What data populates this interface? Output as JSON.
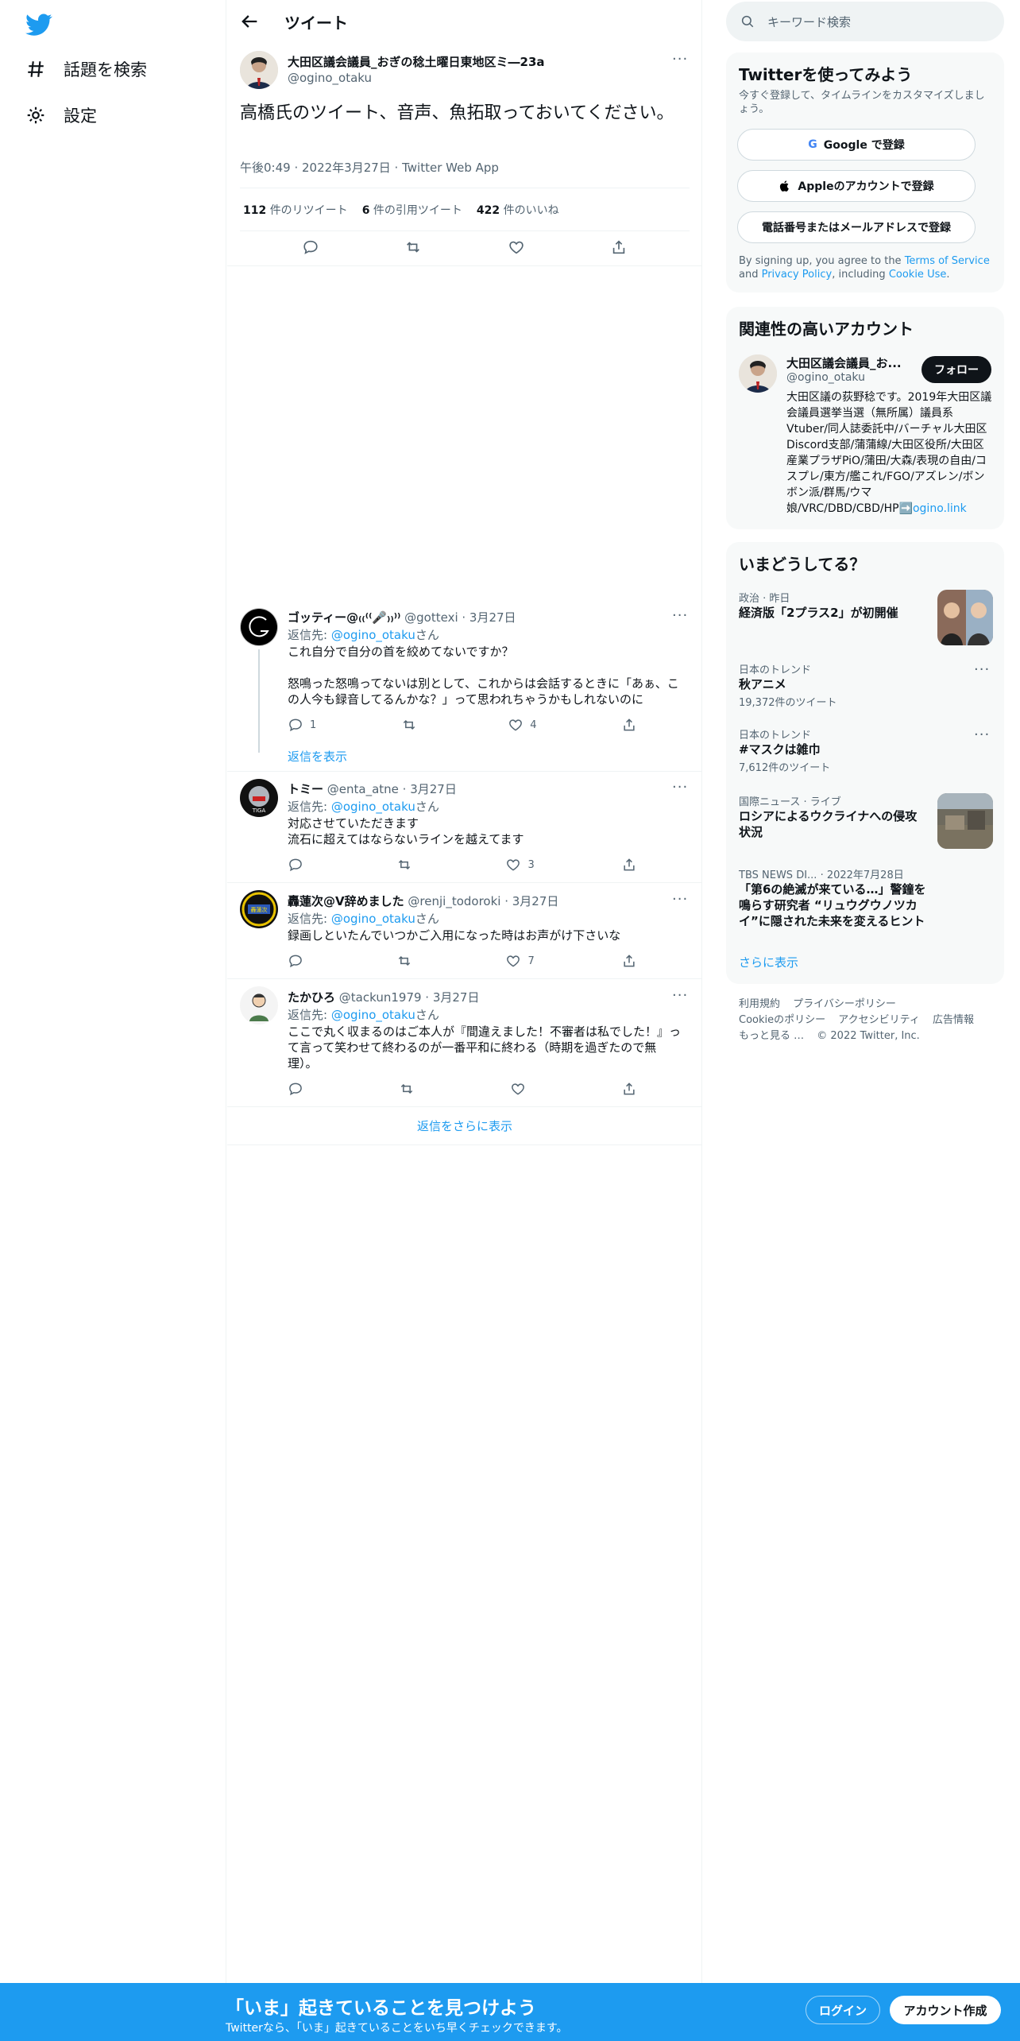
{
  "nav": {
    "logo_icon": "twitter-bird-icon",
    "explore_label": "話題を検索",
    "settings_label": "設定"
  },
  "header": {
    "title": "ツイート"
  },
  "main_tweet": {
    "author_name": "大田区議会議員_おぎの稔土曜日東地区ミ―23a",
    "handle": "@ogino_otaku",
    "text": "高橋氏のツイート、音声、魚拓取っておいてください。",
    "meta": "午後0:49 · 2022年3月27日 · Twitter Web App",
    "retweets_count": "112",
    "retweets_label": "件のリツイート",
    "quotes_count": "6",
    "quotes_label": "件の引用ツイート",
    "likes_count": "422",
    "likes_label": "件のいいね"
  },
  "replies": [
    {
      "name": "ゴッティー@₍₍⁽⁽🎤₎₎⁾⁾",
      "handle": "@gottexi · 3月27日",
      "reply_prefix": "返信先: ",
      "reply_to": "@ogino_otaku",
      "reply_suffix": "さん",
      "text_line1": "これ自分で自分の首を絞めてないですか？",
      "text_line2": "怒鳴った怒鳴ってないは別として、これからは会話するときに「あぁ、この人今も録音してるんかな？」って思われちゃうかもしれないのに",
      "reply_count": "1",
      "retweet_count": "",
      "like_count": "4",
      "show_replies": "返信を表示"
    },
    {
      "name": "トミー",
      "handle": "@enta_atne · 3月27日",
      "reply_prefix": "返信先: ",
      "reply_to": "@ogino_otaku",
      "reply_suffix": "さん",
      "text_line1": "対応させていただきます",
      "text_line2": "流石に超えてはならないラインを越えてます",
      "reply_count": "",
      "retweet_count": "",
      "like_count": "3"
    },
    {
      "name": "轟蓮次@V辞めました",
      "handle": "@renji_todoroki · 3月27日",
      "reply_prefix": "返信先: ",
      "reply_to": "@ogino_otaku",
      "reply_suffix": "さん",
      "text_line1": "録画しといたんでいつかご入用になった時はお声がけ下さいな",
      "reply_count": "",
      "retweet_count": "",
      "like_count": "7"
    },
    {
      "name": "たかひろ",
      "handle": "@tackun1979 · 3月27日",
      "reply_prefix": "返信先: ",
      "reply_to": "@ogino_otaku",
      "reply_suffix": "さん",
      "text_line1": "ここで丸く収まるのはご本人が『間違えました！不審者は私でした！』って言って笑わせて終わるのが一番平和に終わる（時期を過ぎたので無理）。",
      "reply_count": "",
      "retweet_count": "",
      "like_count": ""
    }
  ],
  "show_more_replies": "返信をさらに表示",
  "search": {
    "placeholder": "キーワード検索"
  },
  "signup_panel": {
    "title": "Twitterを使ってみよう",
    "subtitle": "今すぐ登録して、タイムラインをカスタマイズしましょう。",
    "google_btn": "Google で登録",
    "apple_btn": "Appleのアカウントで登録",
    "email_btn": "電話番号またはメールアドレスで登録",
    "tos_prefix": "By signing up, you agree to the ",
    "tos_link": "Terms of Service",
    "tos_and": " and ",
    "privacy_link": "Privacy Policy",
    "tos_incl": ", including ",
    "cookie_link": "Cookie Use",
    "tos_end": "."
  },
  "related_panel": {
    "title": "関連性の高いアカウント",
    "name": "大田区議会議員_お...",
    "handle": "@ogino_otaku",
    "follow_btn": "フォロー",
    "bio": "大田区議の荻野稔です。2019年大田区議会議員選挙当選（無所属）議員系Vtuber/同人誌委託中/バーチャル大田区Discord支部/蒲蒲線/大田区役所/大田区産業プラザPiO/蒲田/大森/表現の自由/コスプレ/東方/艦これ/FGO/アズレン/ボンボン派/群馬/ウマ娘/VRC/DBD/CBD/HP",
    "bio_link": "➡️ogino.link"
  },
  "trends_panel": {
    "title": "いまどうしてる？",
    "items": [
      {
        "ctx": "政治 · 昨日",
        "title": "経済版「2プラス2」が初開催",
        "count": ""
      },
      {
        "ctx": "日本のトレンド",
        "title": "秋アニメ",
        "count": "19,372件のツイート"
      },
      {
        "ctx": "日本のトレンド",
        "title": "#マスクは雑巾",
        "count": "7,612件のツイート"
      },
      {
        "ctx": "国際ニュース · ライブ",
        "title": "ロシアによるウクライナへの侵攻状況",
        "count": ""
      },
      {
        "ctx": "TBS NEWS DI... · 2022年7月28日",
        "title": "「第6の絶滅が来ている…」警鐘を鳴らす研究者 “リュウグウノツカイ”に隠された未来を変えるヒント",
        "count": ""
      }
    ],
    "show_more": "さらに表示"
  },
  "footer": {
    "terms": "利用規約",
    "privacy": "プライバシーポリシー",
    "cookie": "Cookieのポリシー",
    "accessibility": "アクセシビリティ",
    "ads": "広告情報",
    "more": "もっと見る …",
    "copyright": "© 2022 Twitter, Inc."
  },
  "bottom_bar": {
    "title": "「いま」起きていることを見つけよう",
    "subtitle": "Twitterなら、「いま」起きていることをいち早くチェックできます。",
    "login": "ログイン",
    "signup": "アカウント作成"
  },
  "colors": {
    "accent": "#1d9bf0",
    "text": "#0f1419",
    "muted": "#536471",
    "border": "#eff3f4"
  }
}
